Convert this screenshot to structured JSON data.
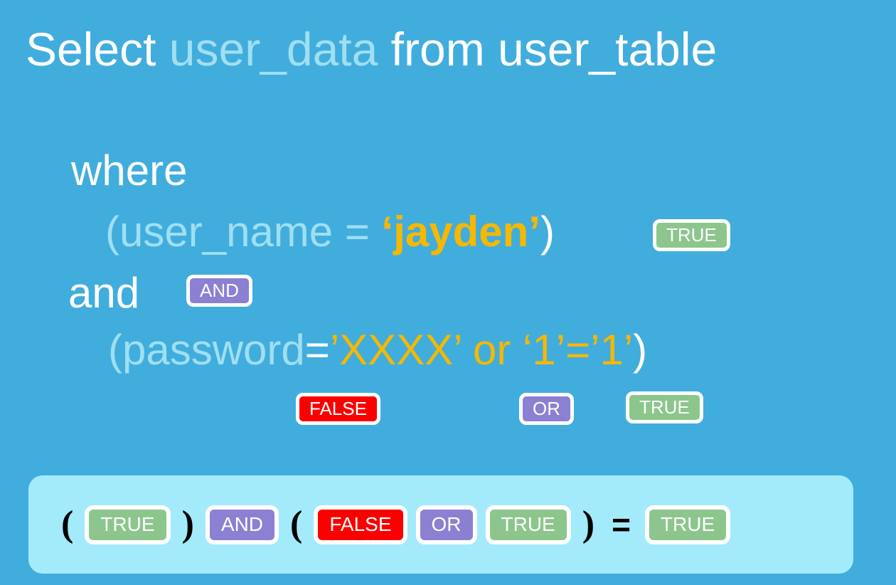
{
  "slide": {
    "background_color": "#41addd",
    "title": {
      "keyword_select": "Select ",
      "identifier_user_data": "user_data",
      "keyword_from": " from ",
      "identifier_user_table": "user_table"
    },
    "query": {
      "where_keyword": "where",
      "condition1": {
        "open_paren": "(",
        "column": "user_name = ",
        "value": "‘jayden’",
        "close_paren": ")"
      },
      "and_keyword": "and",
      "condition2": {
        "open_paren": "(",
        "column": "password",
        "equals": "=",
        "value_password": "’XXXX’",
        "or_keyword": " or ",
        "value_tautology": "‘1’=’1’",
        "close_paren": ")"
      }
    },
    "annotations": {
      "cond1_result": "TRUE",
      "and_operator": "AND",
      "password_result": "FALSE",
      "or_operator": "OR",
      "tautology_result": "TRUE"
    },
    "summary": {
      "open_paren_1": "(",
      "value_1": "TRUE",
      "close_paren_1": ")",
      "operator_1": "AND",
      "open_paren_2": "(",
      "value_2": "FALSE",
      "operator_2": "OR",
      "value_3": "TRUE",
      "close_paren_2": ")",
      "equals": "=",
      "result": "TRUE"
    },
    "colors": {
      "background": "#41addd",
      "identifier": "#9fdff2",
      "literal": "#f6b800",
      "true_badge": "#8cc68c",
      "false_badge": "#fa0000",
      "operator_badge": "#8b80d2",
      "summary_panel": "#a3ebfb",
      "keyword": "#ffffff"
    }
  }
}
